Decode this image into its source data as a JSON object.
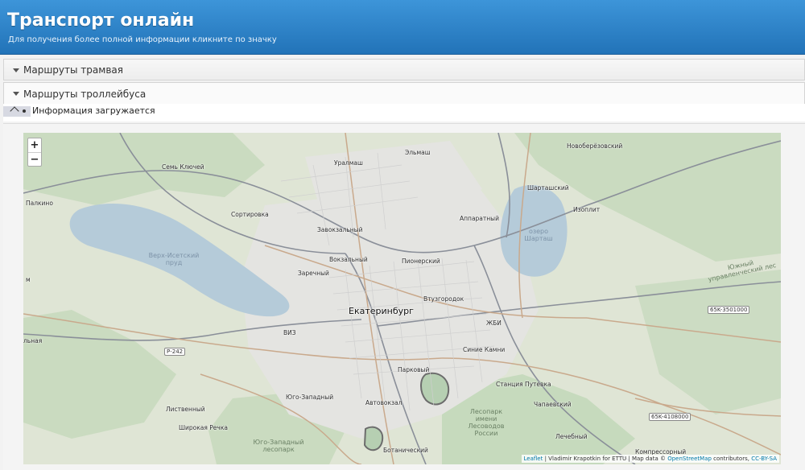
{
  "header": {
    "title": "Транспорт онлайн",
    "subtitle": "Для получения более полной информации кликните по значку"
  },
  "sections": {
    "tram": "Маршруты трамвая",
    "trolleybus": "Маршруты троллейбуса",
    "loading": "Информация загружается"
  },
  "map": {
    "zoom_in": "+",
    "zoom_out": "−",
    "attribution": {
      "leaflet": "Leaflet",
      "author": " | Vladimir Krapotkin for ETTU | Map data © ",
      "osm": "OpenStreetMap",
      "contributors": " contributors, ",
      "license": "CC-BY-SA"
    },
    "labels": {
      "city": "Екатеринбург",
      "elmash": "Эльмаш",
      "novoberezovsky": "Новоберёзовский",
      "sem_klyuchey": "Семь Ключей",
      "uralmash": "Уралмаш",
      "shartashsky": "Шарташский",
      "palkino": "Палкино",
      "sortirovka": "Сортировка",
      "apparatny": "Аппаратный",
      "izoplit": "Изоплит",
      "zavokzalny": "Завокзальный",
      "vokzalny": "Вокзальный",
      "pionersky": "Пионерский",
      "zarechny": "Заречный",
      "vtuzgorodok": "Втузгородок",
      "viz": "ВИЗ",
      "zhbi": "ЖБИ",
      "sinie_kamni": "Синие Камни",
      "parkovy": "Парковый",
      "stantsiya_puteevka": "Станция Путевка",
      "yugo_zapadny": "Юго-Западный",
      "avtovokzal": "Автовокзал",
      "chapaevsky": "Чапаевский",
      "listvenny": "Лиственный",
      "shirokaya_rechka": "Широкая Речка",
      "botanichesky": "Ботанический",
      "lechebny": "Лечебный",
      "kompressorny": "Компрессорный",
      "lake_verkh_isetsky": "Верх-Исетский пруд",
      "lake_shartash": "озеро Шарташ",
      "lesopark_lesovodov": "Лесопарк имени Лесоводов России",
      "lesopark_yugo_zapadny": "Юго-Западный лесопарк",
      "yuzhny_park": "Южный управленческий лес",
      "road_r242": "Р-242",
      "road_65k3501000": "65K-3501000",
      "road_65k4108000": "65K-4108000",
      "edge_m": "м",
      "edge_lnaya": "льная"
    }
  },
  "colors": {
    "header_top": "#3d95d9",
    "header_bottom": "#2273b8",
    "water": "#b5cbd9",
    "forest": "#c9dcbf",
    "land": "#dfe5d5",
    "urban": "#e3e3e0"
  }
}
